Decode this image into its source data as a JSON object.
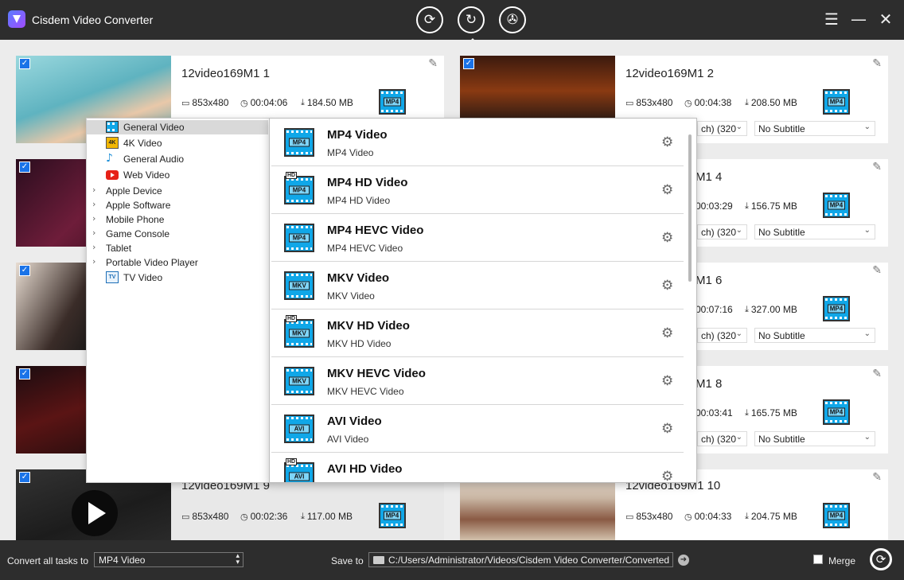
{
  "app": {
    "title": "Cisdem Video Converter"
  },
  "toolbar": {
    "modes": [
      {
        "name": "convert",
        "icon": "convert-icon"
      },
      {
        "name": "download",
        "icon": "download-icon"
      },
      {
        "name": "rip",
        "icon": "film-reel-icon"
      }
    ]
  },
  "tasks": [
    {
      "name": "12video169M1 1",
      "resolution": "853x480",
      "duration": "00:04:06",
      "size": "184.50 MB",
      "format": "MP4"
    },
    {
      "name": "12video169M1 2",
      "resolution": "853x480",
      "duration": "00:04:38",
      "size": "208.50 MB",
      "format": "MP4",
      "audio": "ch) (320",
      "subtitle": "No Subtitle"
    },
    {
      "name": "M1 4",
      "duration": "00:03:29",
      "size": "156.75 MB",
      "format": "MP4",
      "audio": "ch) (320",
      "subtitle": "No Subtitle"
    },
    {
      "name": "M1 6",
      "duration": "00:07:16",
      "size": "327.00 MB",
      "format": "MP4",
      "audio": "ch) (320",
      "subtitle": "No Subtitle"
    },
    {
      "name": "M1 8",
      "duration": "00:03:41",
      "size": "165.75 MB",
      "format": "MP4",
      "audio": "ch) (320",
      "subtitle": "No Subtitle"
    },
    {
      "name": "12video169M1 9",
      "resolution": "853x480",
      "duration": "00:02:36",
      "size": "117.00 MB",
      "format": "MP4"
    },
    {
      "name": "12video169M1 10",
      "resolution": "853x480",
      "duration": "00:04:33",
      "size": "204.75 MB",
      "format": "MP4"
    }
  ],
  "categories": [
    {
      "label": "General Video",
      "icon": "film-strip-icon",
      "active": true
    },
    {
      "label": "4K Video",
      "icon": "4k-video-icon"
    },
    {
      "label": "General Audio",
      "icon": "music-note-icon"
    },
    {
      "label": "Web Video",
      "icon": "youtube-icon"
    },
    {
      "label": "Apple Device",
      "expandable": true
    },
    {
      "label": "Apple Software",
      "expandable": true
    },
    {
      "label": "Mobile Phone",
      "expandable": true
    },
    {
      "label": "Game Console",
      "expandable": true
    },
    {
      "label": "Tablet",
      "expandable": true
    },
    {
      "label": "Portable Video Player",
      "expandable": true
    },
    {
      "label": "TV Video",
      "icon": "tv-icon"
    }
  ],
  "formats": [
    {
      "title": "MP4 Video",
      "subtitle": "MP4 Video",
      "tag": "MP4",
      "hd": ""
    },
    {
      "title": "MP4 HD Video",
      "subtitle": "MP4 HD Video",
      "tag": "MP4",
      "hd": "HD"
    },
    {
      "title": "MP4 HEVC Video",
      "subtitle": "MP4 HEVC Video",
      "tag": "MP4",
      "hd": ""
    },
    {
      "title": "MKV Video",
      "subtitle": "MKV Video",
      "tag": "MKV",
      "hd": ""
    },
    {
      "title": "MKV HD Video",
      "subtitle": "MKV HD Video",
      "tag": "MKV",
      "hd": "HD"
    },
    {
      "title": "MKV HEVC Video",
      "subtitle": "MKV HEVC Video",
      "tag": "MKV",
      "hd": ""
    },
    {
      "title": "AVI Video",
      "subtitle": "AVI Video",
      "tag": "AVI",
      "hd": ""
    },
    {
      "title": "AVI HD Video",
      "subtitle": "",
      "tag": "AVI",
      "hd": "HD"
    }
  ],
  "bottom": {
    "convert_all_label": "Convert all tasks to",
    "convert_all_value": "MP4 Video",
    "save_to_label": "Save to",
    "save_path": "C:/Users/Administrator/Videos/Cisdem Video Converter/Converted",
    "merge_label": "Merge"
  },
  "colors": {
    "accent": "#1a73e8",
    "bar": "#2d2d2d",
    "film": "#10a7e8"
  }
}
